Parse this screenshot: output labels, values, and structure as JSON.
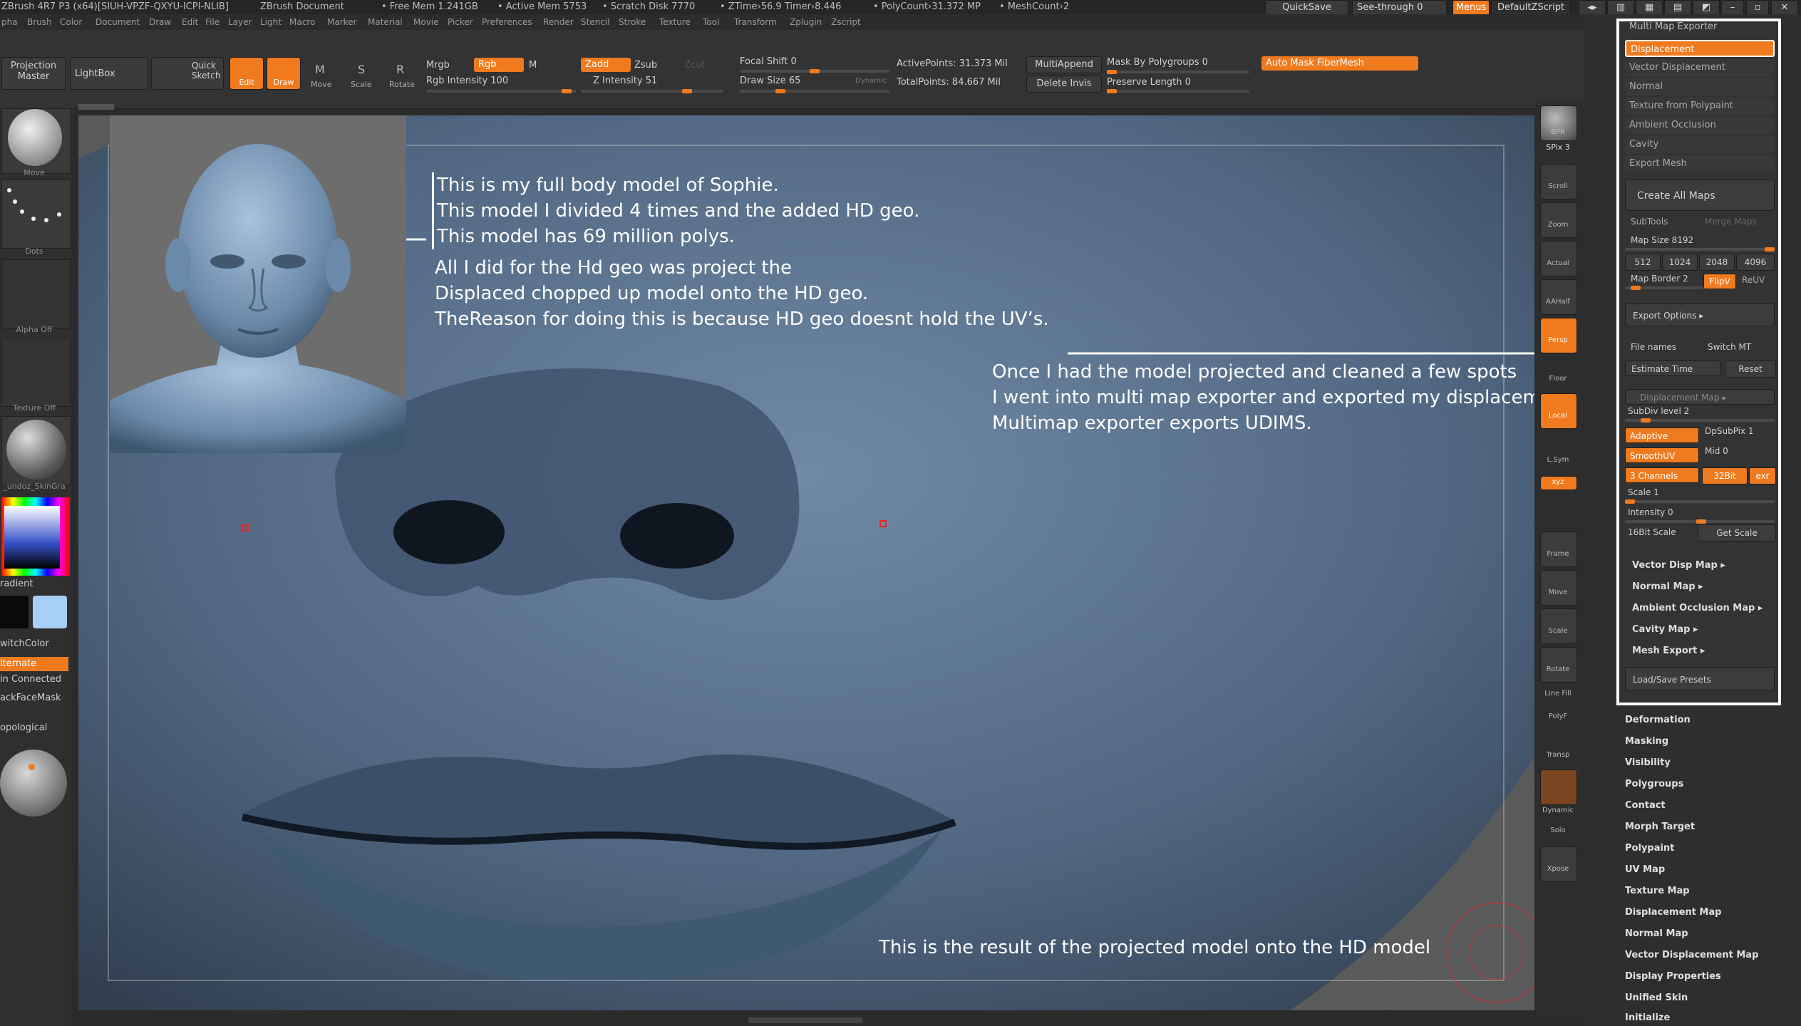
{
  "titlebar": {
    "app": "ZBrush 4R7 P3 (x64)[SIUH-VPZF-QXYU-ICPI-NLIB]",
    "document": "ZBrush Document",
    "free_mem": "• Free Mem 1.241GB",
    "active_mem": "• Active Mem 5753",
    "scratch": "• Scratch Disk 7770",
    "ztime": "• ZTime›56.9 Timer›8.446",
    "polycount": "• PolyCount›31.372  MP",
    "meshcount": "• MeshCount›2",
    "quicksave": "QuickSave",
    "see_through": "See-through  0",
    "menus": "Menus",
    "script": "DefaultZScript"
  },
  "menubar": [
    "pha",
    "Brush",
    "Color",
    "Document",
    "Draw",
    "Edit",
    "File",
    "Layer",
    "Light",
    "Macro",
    "Marker",
    "Material",
    "Movie",
    "Picker",
    "Preferences",
    "Render",
    "Stencil",
    "Stroke",
    "Texture",
    "Tool",
    "Transform",
    "Zplugin",
    "Zscript"
  ],
  "shelf": {
    "projection_master": "Projection Master",
    "lightbox": "LightBox",
    "quick_sketch": "Quick Sketch",
    "edit": "Edit",
    "draw": "Draw",
    "move": "Move",
    "scale": "Scale",
    "rotate": "Rotate",
    "mrgb": "Mrgb",
    "rgb": "Rgb",
    "m": "M",
    "rgb_intensity": "Rgb Intensity 100",
    "zadd": "Zadd",
    "zsub": "Zsub",
    "zcut": "Zcut",
    "z_intensity": "Z Intensity 51",
    "focal_shift": "Focal Shift 0",
    "draw_size": "Draw Size 65",
    "dynamic": "Dynamic",
    "active_points": "ActivePoints: 31.373  Mil",
    "total_points": "TotalPoints: 84.667  Mil",
    "multiappend": "MultiAppend",
    "delete_invis": "Delete Invis",
    "mask_by_polygroups": "Mask By Polygroups 0",
    "preserve_length": "Preserve Length 0",
    "auto_mask": "Auto Mask FiberMesh"
  },
  "left": {
    "move": "Move",
    "dots": "Dots",
    "alpha_off": "Alpha  Off",
    "texture_off": "Texture  Off",
    "material": "_undoz_SkinGra",
    "gradient": "radient",
    "switchcolor": "witchColor",
    "alternate": "lternate",
    "connected": "in Connected",
    "backfacemask": "ackFaceMask",
    "topological": "opological"
  },
  "annotations": {
    "a1": "This is my full body model of Sophie.",
    "a2": "This model I divided 4 times and the added HD geo.",
    "a3": "This model has 69 million polys.",
    "b1": "All I did for the Hd geo was project the",
    "b2": "Displaced chopped up model onto the HD geo.",
    "b3": "TheReason for doing this is because HD geo doesnt hold the UV’s.",
    "c1": "Once I had the model projected and cleaned a few spots",
    "c2": "I went into multi map exporter and exported my displacement map.",
    "c3": "Multimap exporter exports UDIMS.",
    "d1": "This is the result of the projected model onto the HD model"
  },
  "rightnav": {
    "bpr": "BPR",
    "spix": "SPix 3",
    "scroll": "Scroll",
    "zoom": "Zoom",
    "actual": "Actual",
    "aahalf": "AAHalf",
    "persp": "Persp",
    "floor": "Floor",
    "local": "Local",
    "lsym": "L.Sym",
    "xyz": "xyz",
    "frame": "Frame",
    "move": "Move",
    "scale": "Scale",
    "rotate": "Rotate",
    "linefill": "Line Fill",
    "polyf": "PolyF",
    "transp": "Transp",
    "dynamic": "Dynamic",
    "solo": "Solo",
    "xpose": "Xpose"
  },
  "mme": {
    "title": "Multi Map Exporter",
    "maps": [
      "Displacement",
      "Vector Displacement",
      "Normal",
      "Texture from Polypaint",
      "Ambient Occlusion",
      "Cavity",
      "Export Mesh"
    ],
    "create_all": "Create All Maps",
    "subtools": "SubTools",
    "merge_maps": "Merge Maps",
    "map_size": "Map Size 8192",
    "sizes": [
      "512",
      "1024",
      "2048",
      "4096"
    ],
    "map_border": "Map Border 2",
    "flipv": "FlipV",
    "reuv": "ReUV",
    "export_options": "Export Options ▸",
    "file_names": "File names",
    "switch_mt": "Switch MT",
    "estimate_time": "Estimate Time",
    "reset": "Reset",
    "displacement_map": "Displacement Map ▸",
    "subdiv_level": "SubDiv level 2",
    "adaptive": "Adaptive",
    "dpsubpix": "DpSubPix 1",
    "smoothuv": "SmoothUV",
    "mid": "Mid 0",
    "channels": "3 Channels",
    "bit": "32Bit",
    "exr": "exr",
    "scale": "Scale 1",
    "intensity": "Intensity 0",
    "bit16_scale": "16Bit Scale",
    "get_scale": "Get Scale",
    "submenus": [
      "Vector Disp Map ▸",
      "Normal Map ▸",
      "Ambient Occlusion Map ▸",
      "Cavity Map ▸",
      "Mesh Export ▸"
    ],
    "load_save": "Load/Save Presets"
  },
  "tray_items": [
    "Deformation",
    "Masking",
    "Visibility",
    "Polygroups",
    "Contact",
    "Morph Target",
    "Polypaint",
    "UV Map",
    "Texture Map",
    "Displacement Map",
    "Normal Map",
    "Vector Displacement Map",
    "Display Properties",
    "Unified Skin",
    "Initialize"
  ]
}
